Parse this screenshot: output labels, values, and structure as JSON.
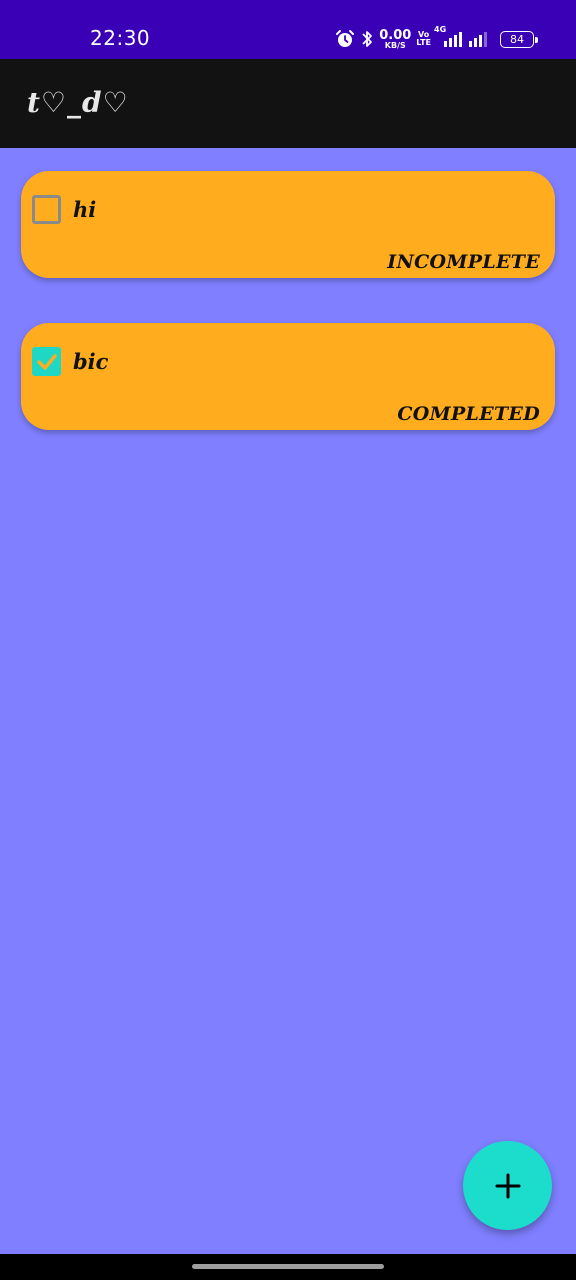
{
  "status_bar": {
    "time": "22:30",
    "net_speed_value": "0.00",
    "net_speed_unit": "KB/S",
    "volte_top": "Vo",
    "volte_bottom": "LTE",
    "network_type": "4G",
    "battery": "84",
    "icons": [
      "alarm-icon",
      "bluetooth-icon",
      "signal-icon",
      "signal-icon",
      "battery-icon"
    ]
  },
  "app_bar": {
    "title": "t♡_d♡"
  },
  "tasks": [
    {
      "title": "hi",
      "status": "INCOMPLETE",
      "checked": false
    },
    {
      "title": "bic",
      "status": "COMPLETED",
      "checked": true
    }
  ],
  "fab": {
    "icon": "plus-icon"
  },
  "colors": {
    "status_bar": "#3a00b5",
    "app_bar": "#121212",
    "background": "#7f7fff",
    "card": "#ffad1f",
    "accent": "#1cdccb"
  }
}
